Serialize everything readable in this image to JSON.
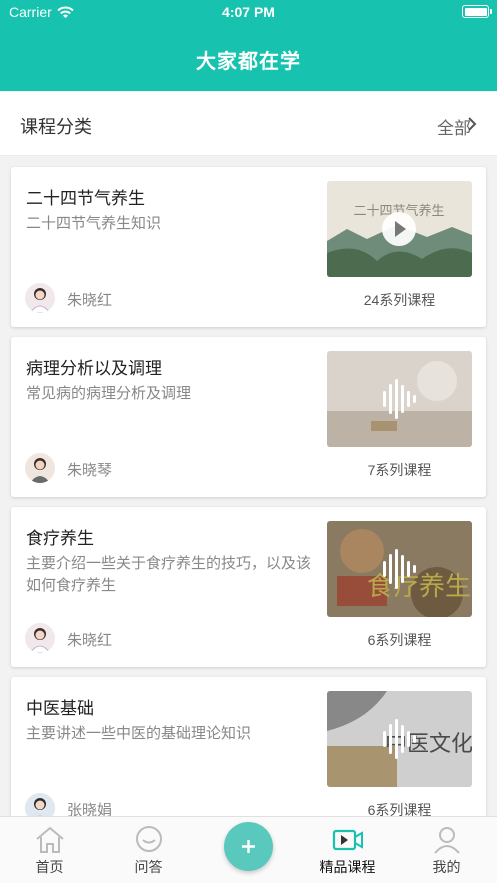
{
  "status_bar": {
    "carrier": "Carrier",
    "time": "4:07 PM"
  },
  "nav": {
    "title": "大家都在学"
  },
  "category": {
    "title": "课程分类",
    "all_label": "全部"
  },
  "courses": [
    {
      "title": "二十四节气养生",
      "desc": "二十四节气养生知识",
      "author": "朱晓红",
      "count": "24系列课程",
      "media": "play",
      "thumb_text": "二十四节气养生"
    },
    {
      "title": "病理分析以及调理",
      "desc": "常见病的病理分析及调理",
      "author": "朱晓琴",
      "count": "7系列课程",
      "media": "audio",
      "thumb_text": ""
    },
    {
      "title": "食疗养生",
      "desc": "主要介绍一些关于食疗养生的技巧，以及该如何食疗养生",
      "author": "朱晓红",
      "count": "6系列课程",
      "media": "audio",
      "thumb_text": "食疗养生"
    },
    {
      "title": "中医基础",
      "desc": "主要讲述一些中医的基础理论知识",
      "author": "张晓娟",
      "count": "6系列课程",
      "media": "audio",
      "thumb_text": "中医文化"
    }
  ],
  "tabbar": {
    "items": [
      {
        "label": "首页",
        "icon": "home-icon"
      },
      {
        "label": "问答",
        "icon": "chat-icon"
      },
      {
        "label": "精品课程",
        "icon": "video-icon",
        "active": true
      },
      {
        "label": "我的",
        "icon": "user-icon"
      }
    ],
    "fab_icon": "plus-icon"
  },
  "colors": {
    "brand": "#17c2ae",
    "fab": "#5ac9bd"
  }
}
